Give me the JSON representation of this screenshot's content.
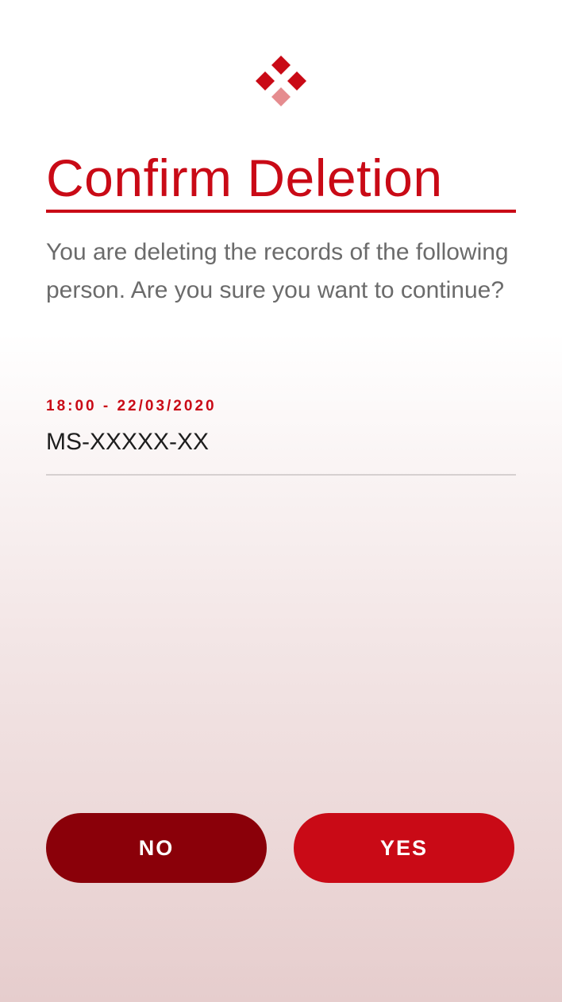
{
  "logo": {
    "icon": "diamond-cluster-logo",
    "color_primary": "#c90a16",
    "color_secondary": "#e58c8f"
  },
  "dialog": {
    "title": "Confirm Deletion",
    "message": "You are deleting the records of the following person. Are you sure you want to continue?"
  },
  "record": {
    "timestamp": "18:00 - 22/03/2020",
    "id": "MS-XXXXX-XX"
  },
  "actions": {
    "no_label": "NO",
    "yes_label": "YES"
  },
  "colors": {
    "accent": "#c90a16",
    "dark_accent": "#8a0009",
    "text_muted": "#6b6b6b",
    "text_dark": "#1e1e1e"
  }
}
